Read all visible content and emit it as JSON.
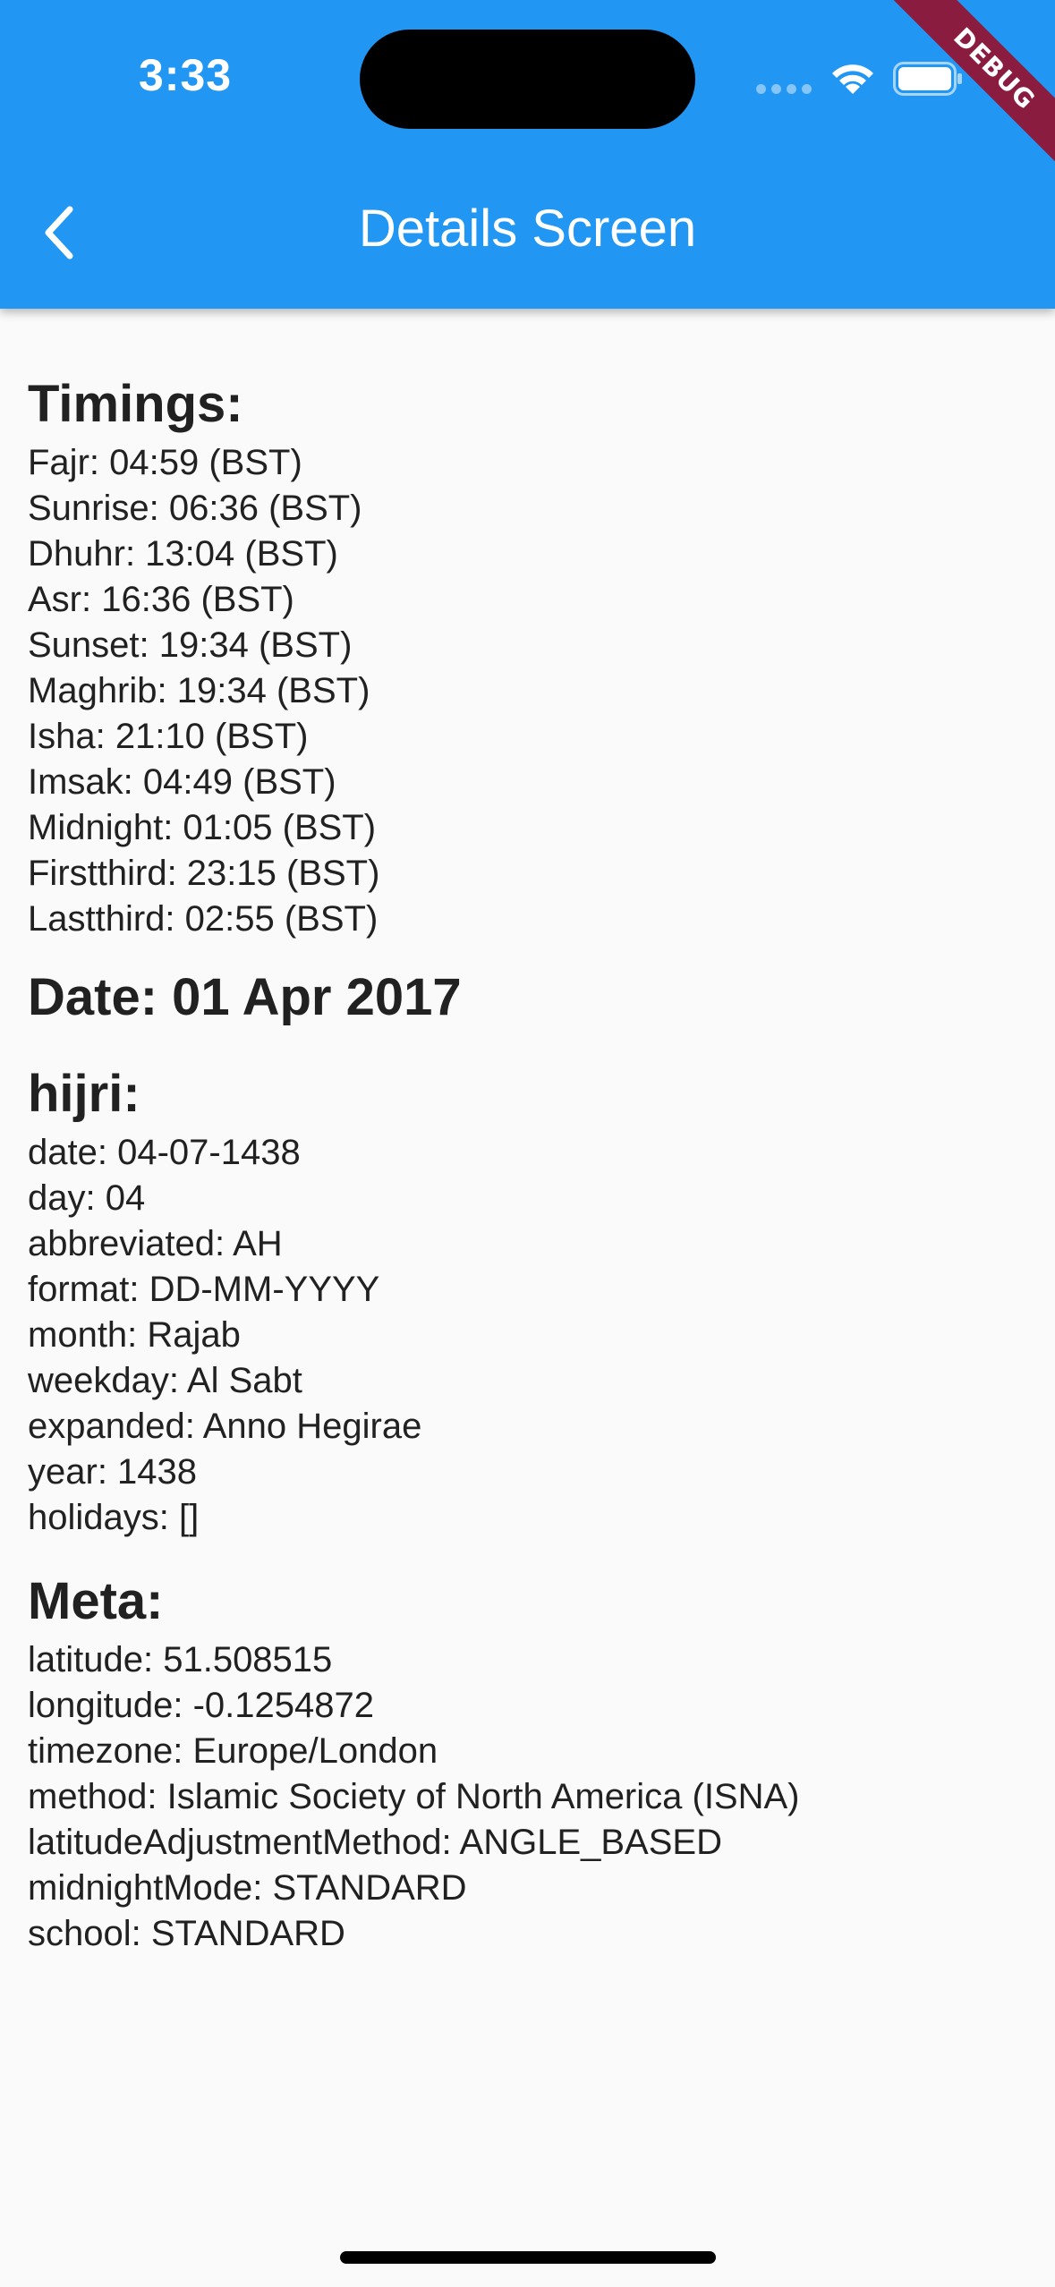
{
  "status_bar": {
    "time": "3:33",
    "debug_label": "DEBUG"
  },
  "app_bar": {
    "title": "Details Screen",
    "back_icon": "chevron-left-icon"
  },
  "timings": {
    "heading": "Timings:",
    "items": [
      "Fajr: 04:59 (BST)",
      "Sunrise: 06:36 (BST)",
      "Dhuhr: 13:04 (BST)",
      "Asr: 16:36 (BST)",
      "Sunset: 19:34 (BST)",
      "Maghrib: 19:34 (BST)",
      "Isha: 21:10 (BST)",
      "Imsak: 04:49 (BST)",
      "Midnight: 01:05 (BST)",
      "Firstthird: 23:15 (BST)",
      "Lastthird: 02:55 (BST)"
    ]
  },
  "date": {
    "heading": "Date: 01 Apr 2017"
  },
  "hijri": {
    "heading": "hijri:",
    "items": [
      "date: 04-07-1438",
      "day: 04",
      "abbreviated: AH",
      "format: DD-MM-YYYY",
      "month: Rajab",
      "weekday: Al Sabt",
      "expanded: Anno Hegirae",
      "year: 1438",
      "holidays: []"
    ]
  },
  "meta": {
    "heading": "Meta:",
    "items": [
      "latitude: 51.508515",
      "longitude: -0.1254872",
      "timezone: Europe/London",
      "method: Islamic Society of North America (ISNA)",
      "latitudeAdjustmentMethod: ANGLE_BASED",
      "midnightMode: STANDARD",
      "school: STANDARD"
    ]
  },
  "colors": {
    "app_bar": "#2196f3",
    "background": "#fafafa",
    "text": "#212121",
    "debug_banner": "#8a1c3f"
  }
}
